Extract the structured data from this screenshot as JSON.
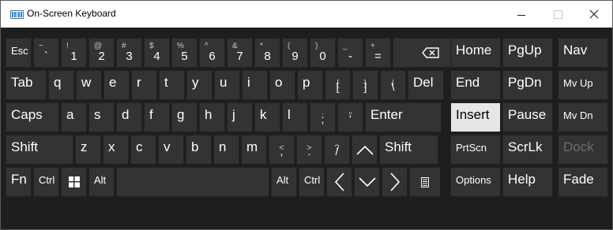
{
  "window": {
    "title": "On-Screen Keyboard"
  },
  "icons": {
    "backspace": "backspace-icon",
    "windows": "windows-logo-icon",
    "up": "arrow-up-icon",
    "down": "arrow-down-icon",
    "left": "arrow-left-icon",
    "right": "arrow-right-icon",
    "menu": "context-menu-icon"
  },
  "keys": {
    "esc": "Esc",
    "tab": "Tab",
    "caps": "Caps",
    "lshift": "Shift",
    "rshift": "Shift",
    "fn": "Fn",
    "lctrl": "Ctrl",
    "rctrl": "Ctrl",
    "lalt": "Alt",
    "ralt": "Alt",
    "del": "Del",
    "enter": "Enter",
    "home": "Home",
    "pgup": "PgUp",
    "nav": "Nav",
    "end": "End",
    "pgdn": "PgDn",
    "mvup": "Mv Up",
    "insert": "Insert",
    "pause": "Pause",
    "mvdn": "Mv Dn",
    "prtscn": "PrtScn",
    "scrlk": "ScrLk",
    "dock": "Dock",
    "options": "Options",
    "help": "Help",
    "fade": "Fade",
    "num": [
      {
        "s": "~",
        "m": "`"
      },
      {
        "s": "!",
        "m": "1"
      },
      {
        "s": "@",
        "m": "2"
      },
      {
        "s": "#",
        "m": "3"
      },
      {
        "s": "$",
        "m": "4"
      },
      {
        "s": "%",
        "m": "5"
      },
      {
        "s": "^",
        "m": "6"
      },
      {
        "s": "&",
        "m": "7"
      },
      {
        "s": "*",
        "m": "8"
      },
      {
        "s": "(",
        "m": "9"
      },
      {
        "s": ")",
        "m": "0"
      },
      {
        "s": "_",
        "m": "-"
      },
      {
        "s": "+",
        "m": "="
      }
    ],
    "row2": [
      "q",
      "w",
      "e",
      "r",
      "t",
      "y",
      "u",
      "i",
      "o",
      "p"
    ],
    "brackets": [
      {
        "s": "{",
        "m": "["
      },
      {
        "s": "}",
        "m": "]"
      },
      {
        "s": "|",
        "m": "\\"
      }
    ],
    "row3": [
      "a",
      "s",
      "d",
      "f",
      "g",
      "h",
      "j",
      "k",
      "l"
    ],
    "row3p": [
      {
        "s": ":",
        "m": ";"
      },
      {
        "s": "\"",
        "m": "'"
      }
    ],
    "row4": [
      "z",
      "x",
      "c",
      "v",
      "b",
      "n",
      "m"
    ],
    "row4p": [
      {
        "s": "<",
        "m": ","
      },
      {
        "s": ">",
        "m": "."
      },
      {
        "s": "?",
        "m": "/"
      }
    ]
  }
}
